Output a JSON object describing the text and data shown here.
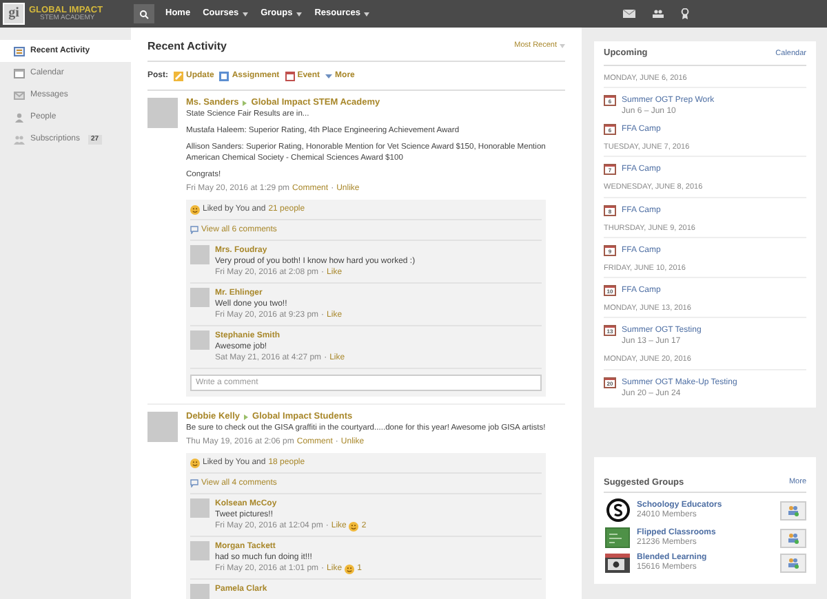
{
  "topbar": {
    "logo": {
      "mark": "gi",
      "title": "GLOBAL IMPACT",
      "subtitle": "STEM ACADEMY"
    },
    "nav": [
      {
        "label": "Home",
        "dropdown": false
      },
      {
        "label": "Courses",
        "dropdown": true
      },
      {
        "label": "Groups",
        "dropdown": true
      },
      {
        "label": "Resources",
        "dropdown": true
      }
    ]
  },
  "sidebar": {
    "items": [
      {
        "label": "Recent Activity",
        "selected": true,
        "kind": "activity"
      },
      {
        "label": "Calendar",
        "selected": false,
        "kind": "calendar"
      },
      {
        "label": "Messages",
        "selected": false,
        "kind": "messages"
      },
      {
        "label": "People",
        "selected": false,
        "kind": "people"
      },
      {
        "label": "Subscriptions",
        "selected": false,
        "kind": "subscriptions",
        "badge": "27"
      }
    ]
  },
  "feed": {
    "title": "Recent Activity",
    "sort": "Most Recent",
    "post_label": "Post:",
    "post_actions": [
      {
        "label": "Update",
        "kind": "update"
      },
      {
        "label": "Assignment",
        "kind": "assignment"
      },
      {
        "label": "Event",
        "kind": "event"
      },
      {
        "label": "More",
        "kind": "more"
      }
    ],
    "posts": [
      {
        "author": "Ms. Sanders",
        "group": "Global Impact STEM Academy",
        "paragraphs": [
          "State Science Fair Results are in...",
          "Mustafa Haleem: Superior Rating, 4th Place Engineering Achievement Award",
          "Allison Sanders: Superior Rating, Honorable Mention for Vet Science Award $150, Honorable Mention American Chemical Society - Chemical Sciences Award $100",
          "Congrats!"
        ],
        "time": "Fri May 20, 2016 at 1:29 pm",
        "actions": [
          "Comment",
          "·",
          "Unlike"
        ],
        "likes_text": "Liked by You and",
        "likes_link": "21 people",
        "view_all": "View all 6 comments",
        "comments": [
          {
            "author": "Mrs. Foudray",
            "text": "Very proud of you both! I know how hard you worked :)",
            "time": "Fri May 20, 2016 at 2:08 pm",
            "separator": "·",
            "like": "Like"
          },
          {
            "author": "Mr. Ehlinger",
            "text": "Well done you two!!",
            "time": "Fri May 20, 2016 at 9:23 pm",
            "separator": "·",
            "like": "Like"
          },
          {
            "author": "Stephanie Smith",
            "text": "Awesome job!",
            "time": "Sat May 21, 2016 at 4:27 pm",
            "separator": "·",
            "like": "Like"
          }
        ],
        "comment_placeholder": "Write a comment"
      },
      {
        "author": "Debbie Kelly",
        "group": "Global Impact Students",
        "paragraphs": [
          "Be sure to check out the GISA graffiti in the courtyard.....done for this year!  Awesome job GISA artists!"
        ],
        "time": "Thu May 19, 2016 at 2:06 pm",
        "actions": [
          "Comment",
          "·",
          "Unlike"
        ],
        "likes_text": "Liked by You and",
        "likes_link": "18 people",
        "view_all": "View all 4 comments",
        "comments": [
          {
            "author": "Kolsean McCoy",
            "text": "Tweet pictures!!",
            "time": "Fri May 20, 2016 at 12:04 pm",
            "separator": "·",
            "like": "Like",
            "like_count": "2"
          },
          {
            "author": "Morgan Tackett",
            "text": "had so much fun doing it!!!",
            "time": "Fri May 20, 2016 at 1:01 pm",
            "separator": "·",
            "like": "Like",
            "like_count": "1"
          },
          {
            "author": "Pamela Clark"
          }
        ]
      }
    ]
  },
  "upcoming": {
    "title": "Upcoming",
    "link": "Calendar",
    "days": [
      {
        "date": "MONDAY, JUNE 6, 2016",
        "events": [
          {
            "day": "6",
            "title": "Summer OGT Prep Work",
            "range": "Jun 6 – Jun 10"
          },
          {
            "day": "6",
            "title": "FFA Camp"
          }
        ]
      },
      {
        "date": "TUESDAY, JUNE 7, 2016",
        "events": [
          {
            "day": "7",
            "title": "FFA Camp"
          }
        ]
      },
      {
        "date": "WEDNESDAY, JUNE 8, 2016",
        "events": [
          {
            "day": "8",
            "title": "FFA Camp"
          }
        ]
      },
      {
        "date": "THURSDAY, JUNE 9, 2016",
        "events": [
          {
            "day": "9",
            "title": "FFA Camp"
          }
        ]
      },
      {
        "date": "FRIDAY, JUNE 10, 2016",
        "events": [
          {
            "day": "10",
            "title": "FFA Camp"
          }
        ]
      },
      {
        "date": "MONDAY, JUNE 13, 2016",
        "events": [
          {
            "day": "13",
            "title": "Summer OGT Testing",
            "range": "Jun 13 – Jun 17"
          }
        ]
      },
      {
        "date": "MONDAY, JUNE 20, 2016",
        "events": [
          {
            "day": "20",
            "title": "Summer OGT Make-Up Testing",
            "range": "Jun 20 – Jun 24"
          }
        ]
      }
    ]
  },
  "suggested": {
    "title": "Suggested Groups",
    "link": "More",
    "groups": [
      {
        "name": "Schoology Educators",
        "members": "24010 Members",
        "kind": "logo"
      },
      {
        "name": "Flipped Classrooms",
        "members": "21236 Members",
        "kind": "chalkboard"
      },
      {
        "name": "Blended Learning",
        "members": "15616 Members",
        "kind": "screen"
      }
    ]
  }
}
